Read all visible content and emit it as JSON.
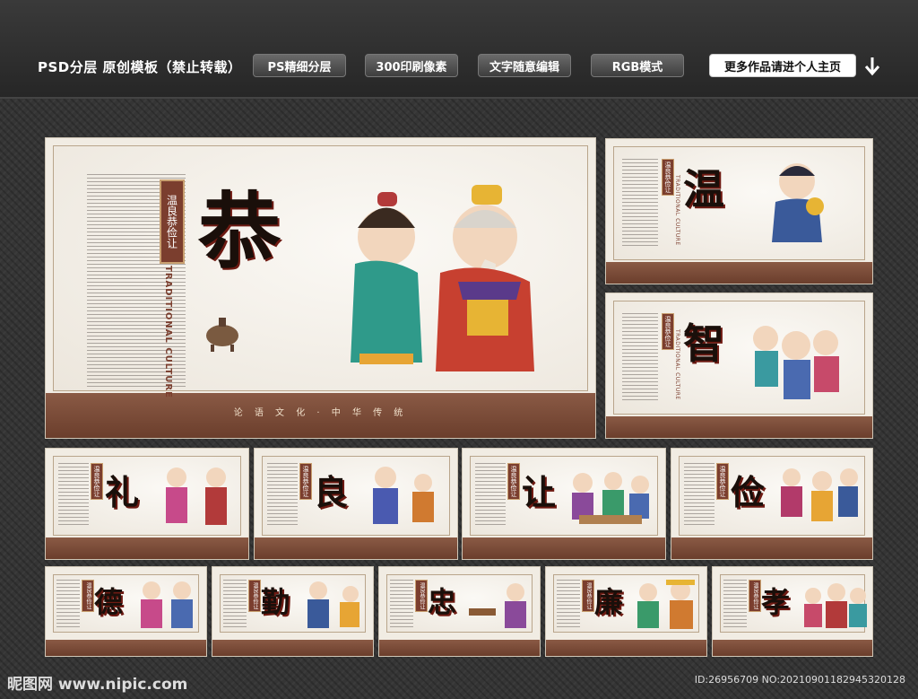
{
  "header": {
    "title": "PSD分层 原创模板（禁止转载）",
    "pills": [
      "PS精细分层",
      "300印刷像素",
      "文字随意编辑",
      "RGB模式"
    ],
    "more_link": "更多作品请进个人主页"
  },
  "main_panel": {
    "big_char": "恭",
    "tag": "温良恭俭让",
    "traditional": "TRADITIONAL CULTURE",
    "footer": "论 语 文 化 · 中 华 传 统"
  },
  "side_panels": [
    {
      "big_char": "温",
      "tag": "温良恭俭让",
      "traditional": "TRADITIONAL CULTURE"
    },
    {
      "big_char": "智",
      "tag": "温良恭俭让",
      "traditional": "TRADITIONAL CULTURE"
    }
  ],
  "row1_panels": [
    {
      "big_char": "礼",
      "tag": "温良恭俭让"
    },
    {
      "big_char": "良",
      "tag": "温良恭俭让"
    },
    {
      "big_char": "让",
      "tag": "温良恭俭让"
    },
    {
      "big_char": "俭",
      "tag": "温良恭俭让"
    }
  ],
  "row2_panels": [
    {
      "big_char": "德",
      "tag": "温良恭俭让"
    },
    {
      "big_char": "勤",
      "tag": "温良恭俭让"
    },
    {
      "big_char": "忠",
      "tag": "温良恭俭让"
    },
    {
      "big_char": "廉",
      "tag": "温良恭俭让"
    },
    {
      "big_char": "孝",
      "tag": "温良恭俭让"
    }
  ],
  "watermark": {
    "logo": "昵图网 www.nipic.com",
    "id": "ID:26956709 NO:20210901182945320128"
  },
  "colors": {
    "accent": "#7b3e2e",
    "footer": "#6b3e2c",
    "paper": "#f1ece3"
  }
}
